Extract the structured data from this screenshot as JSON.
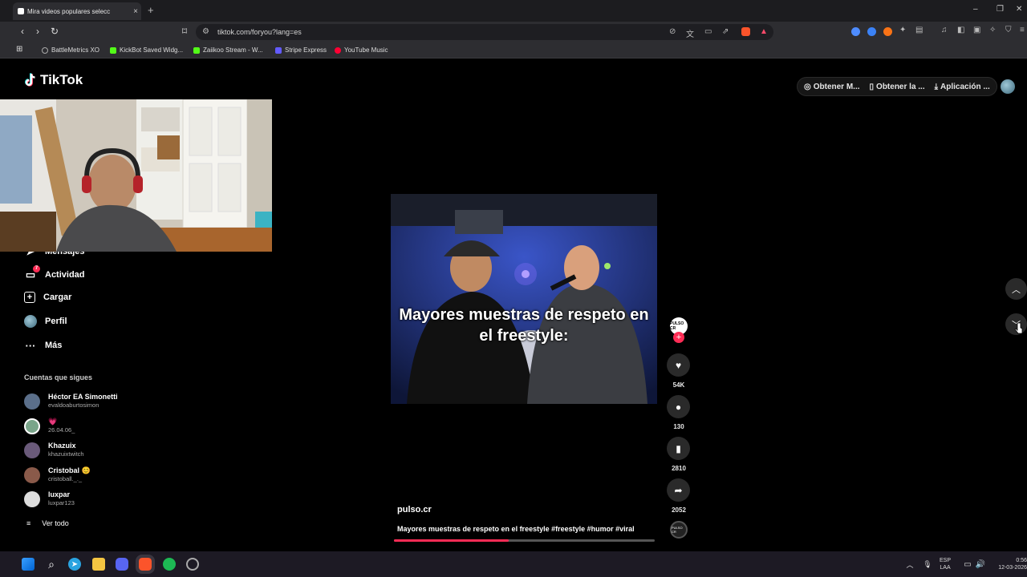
{
  "browser": {
    "tab_title": "Mira videos populares selecc",
    "new_tab": "+",
    "url": "tiktok.com/foryou?lang=es",
    "window_controls": [
      "–",
      "❐",
      "✕"
    ]
  },
  "bookmarks": [
    {
      "label": "BattleMetrics XO",
      "color": "#888"
    },
    {
      "label": "KickBot Saved Widg...",
      "color": "#53fc18"
    },
    {
      "label": "Zaiikoo Stream - W...",
      "color": "#53fc18"
    },
    {
      "label": "Stripe Express",
      "color": "#635bff"
    },
    {
      "label": "YouTube Music",
      "color": "#ff0033"
    }
  ],
  "tiktok": {
    "logo": "TikTok",
    "header_actions": [
      "Obtener M...",
      "Obtener la ...",
      "Aplicación ..."
    ]
  },
  "sidebar": {
    "nav": [
      {
        "label": "Mensajes",
        "icon": "send-icon"
      },
      {
        "label": "Actividad",
        "icon": "inbox-icon",
        "badge": "7"
      },
      {
        "label": "Cargar",
        "icon": "upload-icon"
      },
      {
        "label": "Perfil",
        "icon": "profile-icon"
      },
      {
        "label": "Más",
        "icon": "more-icon"
      }
    ],
    "following_title": "Cuentas que sigues",
    "following": [
      {
        "name": "Héctor EA Simonetti",
        "username": "evaldoaburtosimon",
        "color": "#5b6f8a"
      },
      {
        "name": "💗",
        "username": "26.04.06_",
        "color": "#7aa58a"
      },
      {
        "name": "Khazuix",
        "username": "khazuixtwitch",
        "color": "#6a5a7a"
      },
      {
        "name": "Cristobal 😊",
        "username": "cristoball._._",
        "color": "#8a5a4a"
      },
      {
        "name": "luxpar",
        "username": "luxpar123",
        "color": "#dddddd"
      }
    ],
    "see_all": "Ver todo"
  },
  "video": {
    "overlay_caption": "Mayores muestras de respeto en el freestyle:",
    "author": "pulso.cr",
    "description": "Mayores muestras de respeto en el freestyle #freestyle #humor #viral",
    "progress": 0.44,
    "creator_badge": "PULSO CR",
    "likes": "54K",
    "comments": "130",
    "saves": "2810",
    "shares": "2052"
  },
  "taskbar": {
    "lang": "ESP",
    "lang2": "LAA",
    "time": "0:56",
    "date": "12-03-2026"
  }
}
